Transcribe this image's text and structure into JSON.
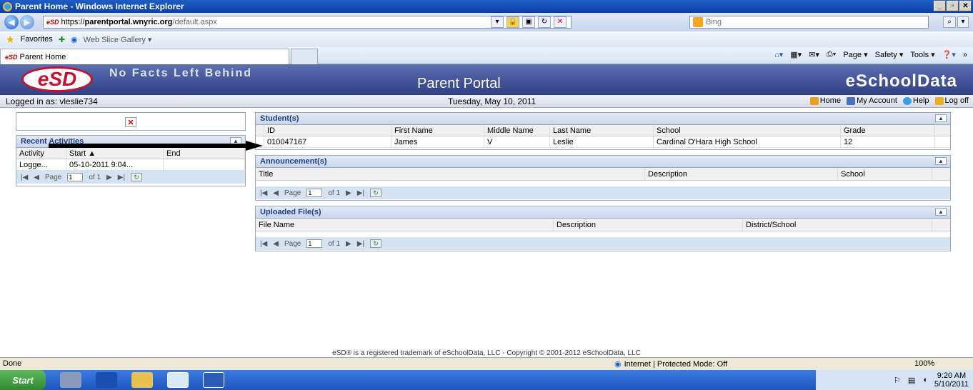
{
  "window": {
    "title": "Parent Home - Windows Internet Explorer"
  },
  "address": {
    "url_scheme": "https://",
    "url_host": "parentportal.wnyric.org",
    "url_path": "/default.aspx",
    "search_placeholder": "Bing"
  },
  "favorites": {
    "label": "Favorites",
    "web_slice": "Web Slice Gallery ▾"
  },
  "tab": {
    "title": "Parent Home"
  },
  "commands": {
    "page": "Page ▾",
    "safety": "Safety ▾",
    "tools": "Tools ▾"
  },
  "banner": {
    "logo": "eSD",
    "tagline": "No Facts Left Behind",
    "portal": "Parent Portal",
    "brand": "eSchoolData"
  },
  "info": {
    "logged_in": "Logged in as: vleslie734",
    "date": "Tuesday, May 10, 2011",
    "home": "Home",
    "account": "My Account",
    "help": "Help",
    "logoff": "Log off"
  },
  "recent": {
    "title": "Recent Activities",
    "columns": [
      "Activity",
      "Start ▲",
      "End"
    ],
    "rows": [
      [
        "Logge...",
        "05-10-2011 9:04...",
        ""
      ]
    ],
    "pager": {
      "page_label": "Page",
      "page": "1",
      "of": "of 1"
    }
  },
  "students": {
    "title": "Student(s)",
    "columns": [
      "ID",
      "First Name",
      "Middle Name",
      "Last Name",
      "School",
      "Grade"
    ],
    "rows": [
      [
        "010047167",
        "James",
        "V",
        "Leslie",
        "Cardinal O'Hara High School",
        "12"
      ]
    ]
  },
  "announcements": {
    "title": "Announcement(s)",
    "columns": [
      "Title",
      "Description",
      "School"
    ],
    "pager": {
      "page_label": "Page",
      "page": "1",
      "of": "of 1"
    }
  },
  "uploads": {
    "title": "Uploaded File(s)",
    "columns": [
      "File Name",
      "Description",
      "District/School"
    ],
    "pager": {
      "page_label": "Page",
      "page": "1",
      "of": "of 1"
    }
  },
  "footer": {
    "copyright": "eSD® is a registered trademark of eSchoolData, LLC - Copyright © 2001-2012 eSchoolData, LLC"
  },
  "status": {
    "done": "Done",
    "zone": "Internet | Protected Mode: Off",
    "zoom": "100%"
  },
  "taskbar": {
    "start": "Start",
    "time": "9:20 AM",
    "date": "5/10/2011"
  }
}
